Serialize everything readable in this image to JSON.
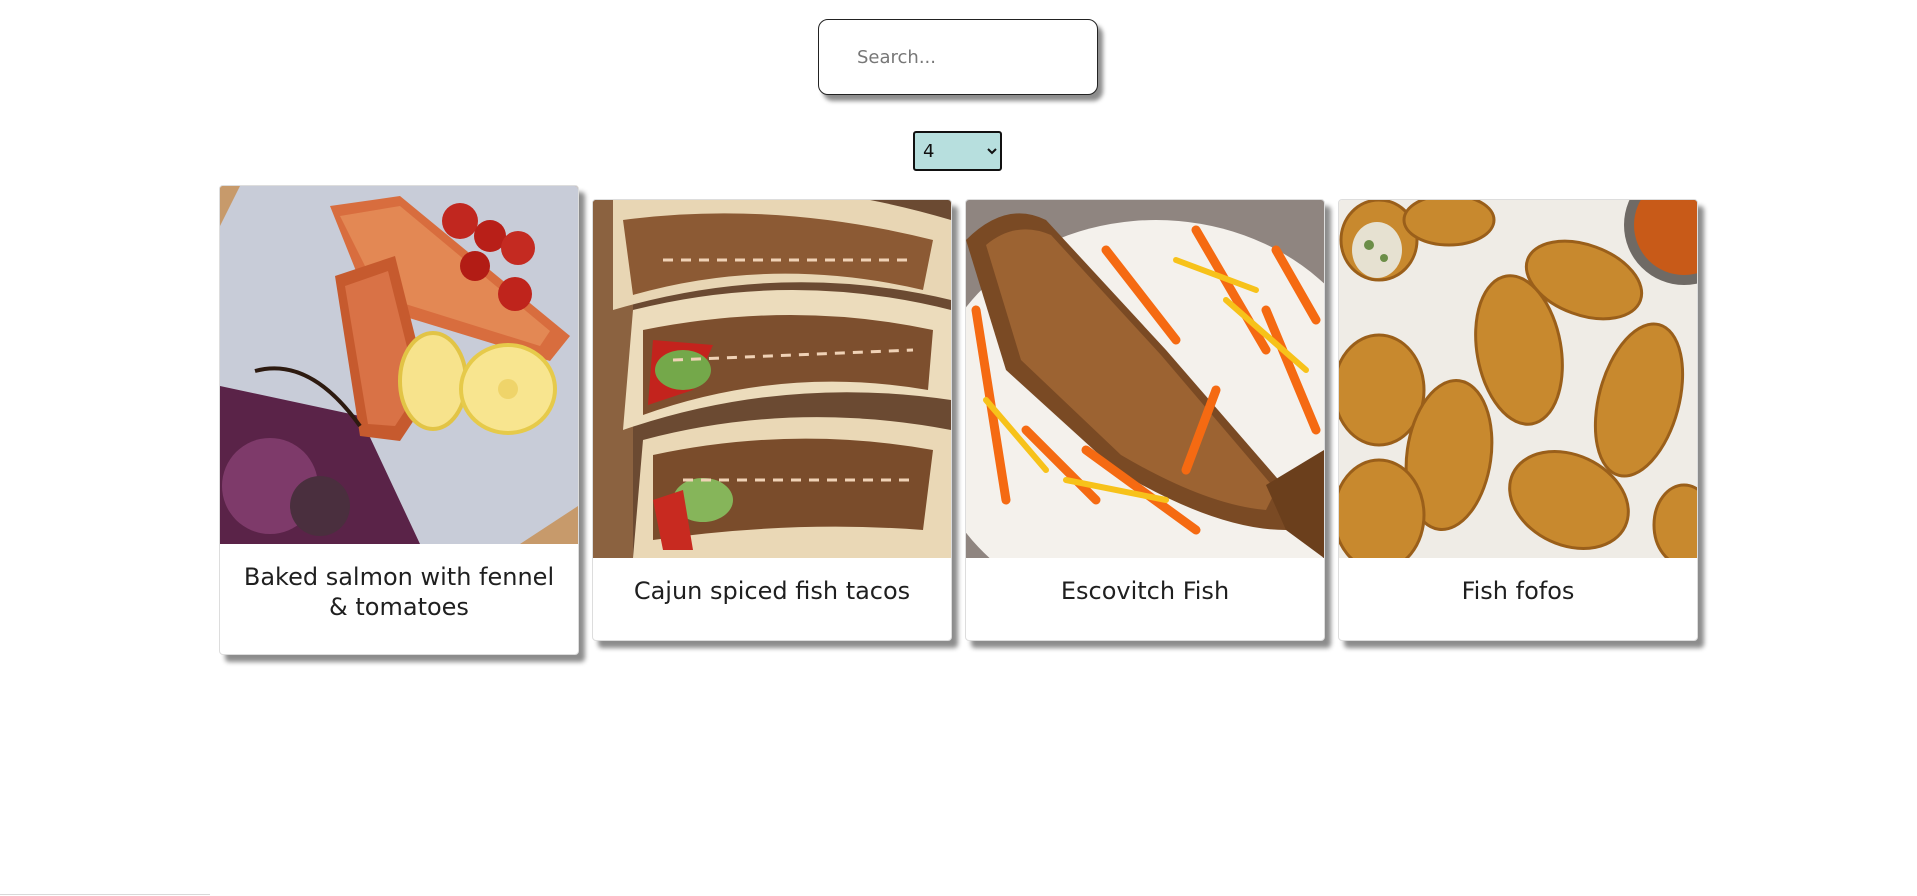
{
  "search": {
    "placeholder": "Search...",
    "value": ""
  },
  "count_select": {
    "selected": "4"
  },
  "colors": {
    "select_bg": "#b7dfde",
    "page_bg": "#ffffff"
  },
  "recipes": [
    {
      "title": "Baked salmon with fennel & tomatoes",
      "image": "baked-salmon-photo"
    },
    {
      "title": "Cajun spiced fish tacos",
      "image": "fish-tacos-photo"
    },
    {
      "title": "Escovitch Fish",
      "image": "escovitch-fish-photo"
    },
    {
      "title": "Fish fofos",
      "image": "fish-fofos-photo"
    }
  ]
}
